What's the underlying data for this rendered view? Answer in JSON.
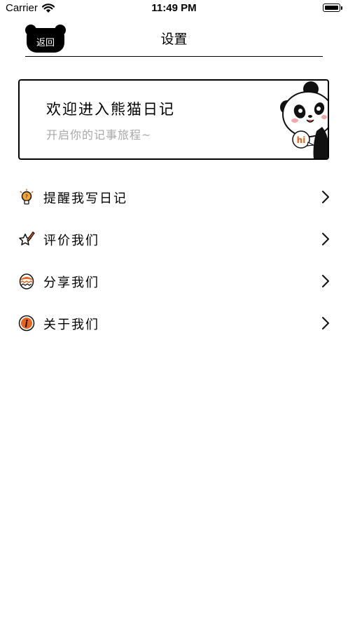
{
  "status_bar": {
    "carrier": "Carrier",
    "time": "11:49 PM"
  },
  "nav": {
    "back_label": "返回",
    "title": "设置"
  },
  "welcome": {
    "title": "欢迎进入熊猫日记",
    "subtitle": "开启你的记事旅程~",
    "badge_text": "hi"
  },
  "menu": [
    {
      "label": "提醒我写日记",
      "icon": "lightbulb-icon"
    },
    {
      "label": "评价我们",
      "icon": "star-pencil-icon"
    },
    {
      "label": "分享我们",
      "icon": "egg-icon"
    },
    {
      "label": "关于我们",
      "icon": "info-icon"
    }
  ],
  "colors": {
    "accent_orange": "#e8631c",
    "subtitle_gray": "#a8a8a8",
    "text": "#000000"
  }
}
